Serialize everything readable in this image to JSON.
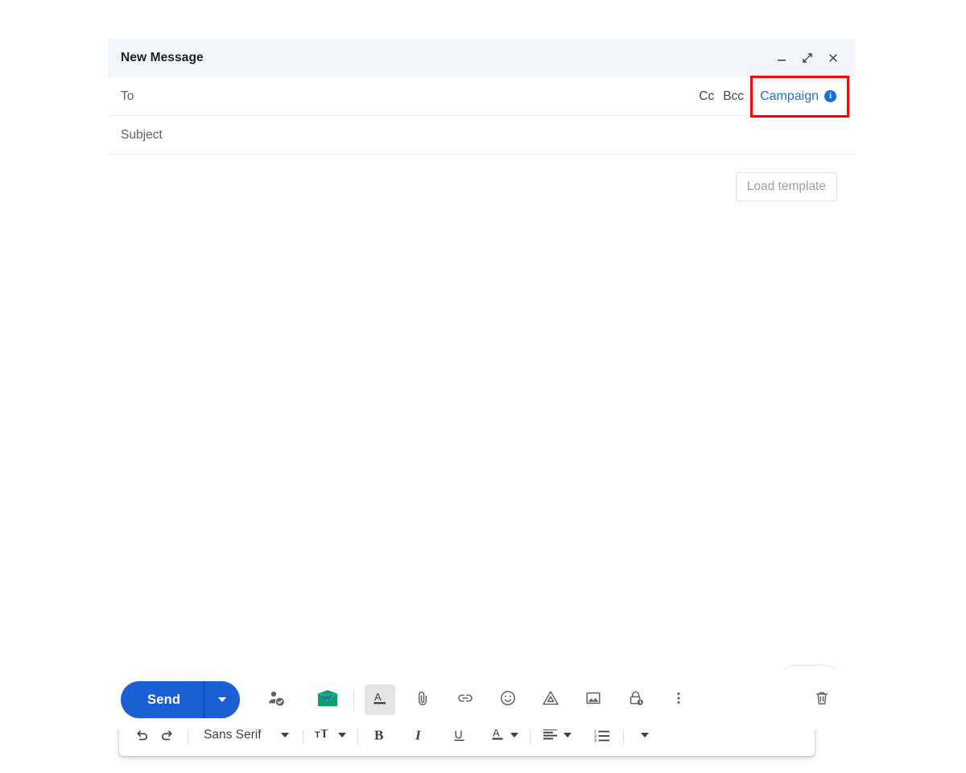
{
  "window": {
    "title": "New Message",
    "controls": [
      {
        "name": "minimize",
        "icon": "minimize-icon",
        "label": "_"
      },
      {
        "name": "popout",
        "icon": "popout-icon",
        "label": "↗"
      },
      {
        "name": "close",
        "icon": "close-icon",
        "label": "×"
      }
    ]
  },
  "fields": {
    "to": {
      "label": "To",
      "value": "",
      "placeholder": "To"
    },
    "subject": {
      "label": "Subject",
      "value": "",
      "placeholder": "Subject"
    },
    "cc": "Cc",
    "bcc": "Bcc",
    "campaign": {
      "label": "Campaign",
      "info_icon": "info-icon",
      "info_glyph": "i"
    }
  },
  "body": {
    "load_template": "Load template",
    "content": "",
    "assistants": [
      {
        "name": "smart-compose-lightbulb",
        "icon": "lightbulb-icon",
        "color": "#0f9b82"
      },
      {
        "name": "grammarly",
        "icon": "grammarly-g-icon",
        "color": "#15806c"
      }
    ]
  },
  "format_toolbar": {
    "undo": "undo-icon",
    "redo": "redo-icon",
    "font_family": "Sans Serif",
    "font_size_icon": "font-size-icon",
    "bold": "B",
    "italic": "I",
    "underline": "U",
    "text_color": "A",
    "align": "align-icon",
    "numbered_list": "numbered-list-icon",
    "more": "more-format-icon"
  },
  "action_bar": {
    "send": "Send",
    "send_options": "send-options-caret",
    "items": [
      {
        "name": "confirm-recipient",
        "icon": "person-check-icon",
        "label": ""
      },
      {
        "name": "mailtrack",
        "icon": "mailtrack-envelope-icon",
        "label": ""
      },
      {
        "name": "formatting-options",
        "icon": "formatting-a-icon",
        "label": "A",
        "active": true
      },
      {
        "name": "attach-files",
        "icon": "paperclip-icon",
        "label": ""
      },
      {
        "name": "insert-link",
        "icon": "link-icon",
        "label": ""
      },
      {
        "name": "insert-emoji",
        "icon": "emoji-icon",
        "label": ""
      },
      {
        "name": "insert-drive-file",
        "icon": "google-drive-icon",
        "label": ""
      },
      {
        "name": "insert-photo",
        "icon": "photo-icon",
        "label": ""
      },
      {
        "name": "confidential-mode",
        "icon": "lock-clock-icon",
        "label": ""
      },
      {
        "name": "more-options",
        "icon": "more-vert-icon",
        "label": ""
      },
      {
        "name": "discard-draft",
        "icon": "trash-icon",
        "label": ""
      }
    ]
  },
  "annotation": {
    "highlight_target": "Campaign",
    "highlight_color": "#fe0000"
  },
  "colors": {
    "header_bg": "#f2f6fc",
    "send_blue": "#1a5fd4",
    "link_blue": "#1a73e8",
    "grammarly_teal": "#15806c",
    "text_primary": "#202124",
    "text_secondary": "#5f6368"
  }
}
